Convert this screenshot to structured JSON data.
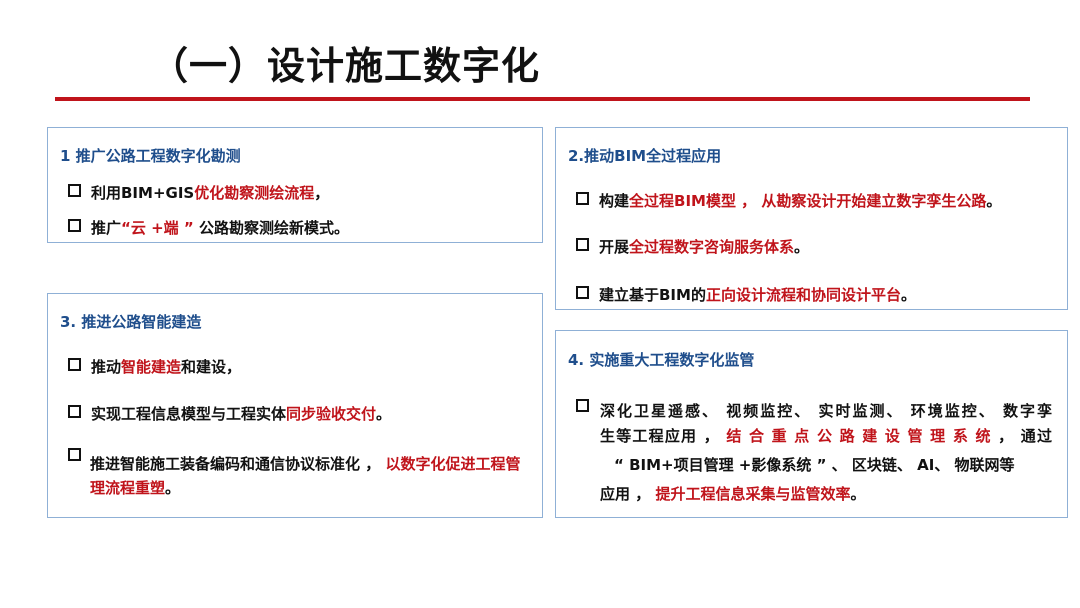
{
  "page": {
    "title": "（一）设计施工数字化"
  },
  "panels": {
    "p1": {
      "heading": "1  推广公路工程数字化勘测",
      "b1": {
        "t1": "利用BIM+GIS",
        "r1": "优化勘察测绘流程",
        "t2": "，"
      },
      "b2": {
        "t1": "推广",
        "r1": "“云 +端 ”",
        "t2": " 公路勘察测绘新模式。"
      }
    },
    "p2": {
      "heading": "2.推动BIM全过程应用",
      "b1": {
        "t1": "构建",
        "r1": "全过程BIM模型 ， 从勘察设计开始建立数字孪生公路",
        "t2": "。"
      },
      "b2": {
        "t1": "开展",
        "r1": "全过程数字咨询服务体系",
        "t2": "。"
      },
      "b3": {
        "t1": "建立基于BIM的",
        "r1": "正向设计流程和协同设计平台",
        "t2": "。"
      }
    },
    "p3": {
      "heading": "3.  推进公路智能建造",
      "b1": {
        "t1": "推动",
        "r1": "智能建造",
        "t2": "和建设，"
      },
      "b2": {
        "t1": "实现工程信息模型与工程实体",
        "r1": "同步验收交付",
        "t2": "。"
      },
      "b3": {
        "t1": "推进智能施工装备编码和通信协议标准化 ， ",
        "r1": "以数字化促进工程管理流程重塑",
        "t2": "。"
      }
    },
    "p4": {
      "heading": "4.  实施重大工程数字化监管",
      "line1": "深化卫星遥感、 视频监控、 实时监测、 环境监控、 数字孪",
      "line2_t1": "生等工程应用 ， ",
      "line2_r1": "结 合 重 点 公 路 建 设 管 理 系 统",
      "line2_t2": " ， 通过",
      "line3": "“ BIM+项目管理 +影像系统 ” 、 区块链、 AI、 物联网等",
      "line4_t1": "应用 ， ",
      "line4_r1": "提升工程信息采集与监管效率",
      "line4_t2": "。"
    }
  }
}
